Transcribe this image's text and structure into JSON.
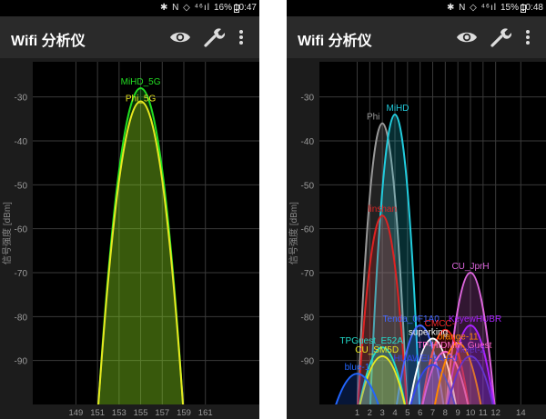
{
  "screens": [
    {
      "status": {
        "icons": "✱ N ◇ ⁴⁶ıl",
        "battery": "16%",
        "time": "10:47"
      },
      "app_title": "Wifi 分析仪",
      "toolbar": {
        "view_icon": "eye-icon",
        "tools_icon": "wrench-icon",
        "menu_icon": "more-vert-icon"
      }
    },
    {
      "status": {
        "icons": "✱ N ◇ ⁴⁶ıl",
        "battery": "15%",
        "time": "10:48"
      },
      "app_title": "Wifi 分析仪",
      "toolbar": {
        "view_icon": "eye-icon",
        "tools_icon": "wrench-icon",
        "menu_icon": "more-vert-icon"
      }
    }
  ],
  "chart_data": [
    {
      "type": "area",
      "ylabel": "信号强度 [dBm]",
      "ylim": [
        -100,
        -22
      ],
      "yticks": [
        -30,
        -40,
        -50,
        -60,
        -70,
        -80,
        -90
      ],
      "xlim": [
        145,
        166
      ],
      "xticks": [
        149,
        151,
        153,
        155,
        157,
        159,
        161
      ],
      "grid": true,
      "series": [
        {
          "name": "MiHD_5G",
          "color": "#22dd22",
          "channel": 155,
          "width": 8,
          "peak": -28
        },
        {
          "name": "Phi_5G",
          "color": "#e8e820",
          "channel": 155,
          "width": 8,
          "peak": -31
        }
      ]
    },
    {
      "type": "area",
      "ylabel": "信号强度 [dBm]",
      "ylim": [
        -100,
        -22
      ],
      "yticks": [
        -30,
        -40,
        -50,
        -60,
        -70,
        -80,
        -90
      ],
      "xlim": [
        -2,
        16
      ],
      "xticks": [
        1,
        2,
        3,
        4,
        5,
        6,
        7,
        8,
        9,
        10,
        11,
        12,
        14
      ],
      "grid": true,
      "series": [
        {
          "name": "Phi",
          "color": "#999999",
          "channel": 3,
          "width": 4,
          "peak": -36
        },
        {
          "name": "MiHD",
          "color": "#22ccdd",
          "channel": 4,
          "width": 4,
          "peak": -34
        },
        {
          "name": "linshan",
          "color": "#dd2222",
          "channel": 3,
          "width": 4,
          "peak": -57
        },
        {
          "name": "CU_JprH",
          "color": "#dd66dd",
          "channel": 10,
          "width": 4,
          "peak": -70
        },
        {
          "name": "Tenda_0F1A0",
          "color": "#4466ff",
          "channel": 6,
          "width": 4,
          "peak": -82
        },
        {
          "name": "CMCC-",
          "color": "#ee2222",
          "channel": 8,
          "width": 4,
          "peak": -83
        },
        {
          "name": "KeyewHUBR",
          "color": "#aa22ff",
          "channel": 10,
          "width": 4,
          "peak": -82
        },
        {
          "name": "superking",
          "color": "#ffffff",
          "channel": 7,
          "width": 4,
          "peak": -85
        },
        {
          "name": "TPGuest_E52A",
          "color": "#22ddcc",
          "channel": 3,
          "width": 4,
          "peak": -87
        },
        {
          "name": "CU_SM5D",
          "color": "#e8e820",
          "channel": 3,
          "width": 4,
          "peak": -89
        },
        {
          "name": "TP-HIDMM_Guest",
          "color": "#ff66cc",
          "channel": 8,
          "width": 4,
          "peak": -88
        },
        {
          "name": "HUAWEI-2A-F0",
          "color": "#3344ee",
          "channel": 7,
          "width": 4,
          "peak": -91
        },
        {
          "name": "orange-11",
          "color": "#ff8800",
          "channel": 9,
          "width": 4,
          "peak": -86
        },
        {
          "name": "violet-2",
          "color": "#6633cc",
          "channel": 10,
          "width": 4,
          "peak": -89
        },
        {
          "name": "blue-1",
          "color": "#2266ff",
          "channel": 1,
          "width": 4,
          "peak": -93
        }
      ]
    }
  ]
}
